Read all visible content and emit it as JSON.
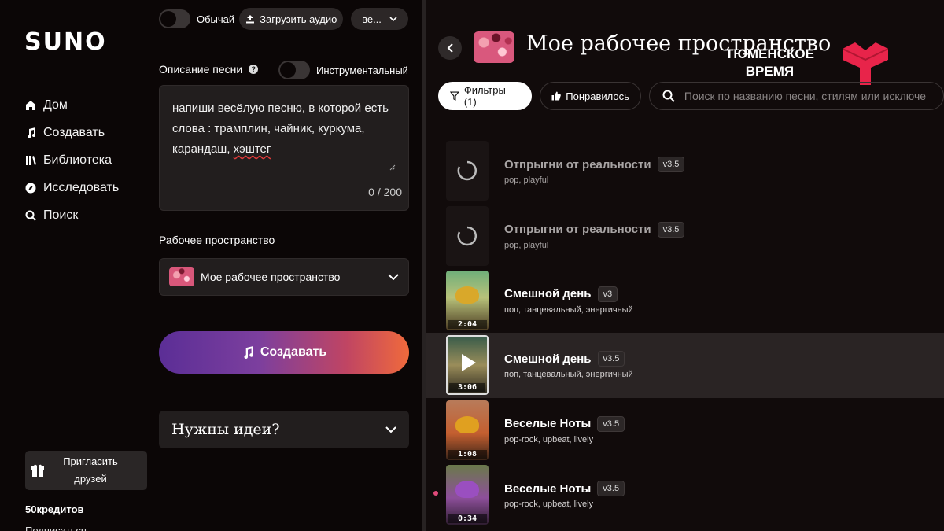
{
  "nav": {
    "logo": "SUNO",
    "items": [
      {
        "label": "Дом",
        "icon": "home-icon"
      },
      {
        "label": "Создавать",
        "icon": "music-note-icon"
      },
      {
        "label": "Библиотека",
        "icon": "library-icon"
      },
      {
        "label": "Исследовать",
        "icon": "compass-icon"
      },
      {
        "label": "Поиск",
        "icon": "search-icon"
      }
    ],
    "invite_label": "Пригласить друзей",
    "credits": "50кредитов",
    "subscribe": "Подписаться"
  },
  "create": {
    "mode_label": "Обычай",
    "upload_label": "Загрузить аудио",
    "version_label": "ве...",
    "description_label": "Описание песни",
    "instrumental_label": "Инструментальный",
    "prompt_main": "напиши весёлую песню, в которой есть слова : трамплин, чайник, куркума, карандаш, ",
    "prompt_tail": "хэштег",
    "counter": "0 / 200",
    "workspace_label": "Рабочее пространство",
    "workspace_value": "Мое рабочее пространство",
    "create_button": "Создавать",
    "ideas_label": "Нужны идеи?"
  },
  "workspace": {
    "title": "Мое рабочее пространство",
    "watermark_line1": "ТЮМЕНСКОЕ",
    "watermark_line2": "ВРЕМЯ",
    "filters_label": "Фильтры (1)",
    "liked_label": "Понравилось",
    "search_placeholder": "Поиск по названию песни, стилям или исключе",
    "songs": [
      {
        "title": "Отпрыгни от реальности",
        "version": "v3.5",
        "tags": "pop, playful",
        "duration": ""
      },
      {
        "title": "Отпрыгни от реальности",
        "version": "v3.5",
        "tags": "pop, playful",
        "duration": ""
      },
      {
        "title": "Смешной день",
        "version": "v3",
        "tags": "поп, танцевальный, энергичный",
        "duration": "2:04"
      },
      {
        "title": "Смешной день",
        "version": "v3.5",
        "tags": "поп, танцевальный, энергичный",
        "duration": "3:06"
      },
      {
        "title": "Веселые Ноты",
        "version": "v3.5",
        "tags": "pop-rock, upbeat, lively",
        "duration": "1:08"
      },
      {
        "title": "Веселые Ноты",
        "version": "v3.5",
        "tags": "pop-rock, upbeat, lively",
        "duration": "0:34"
      }
    ]
  },
  "colors": {
    "background": "#0b0606",
    "panel": "#221e1e",
    "accent_start": "#5b2e96",
    "accent_end": "#f06a3c"
  }
}
